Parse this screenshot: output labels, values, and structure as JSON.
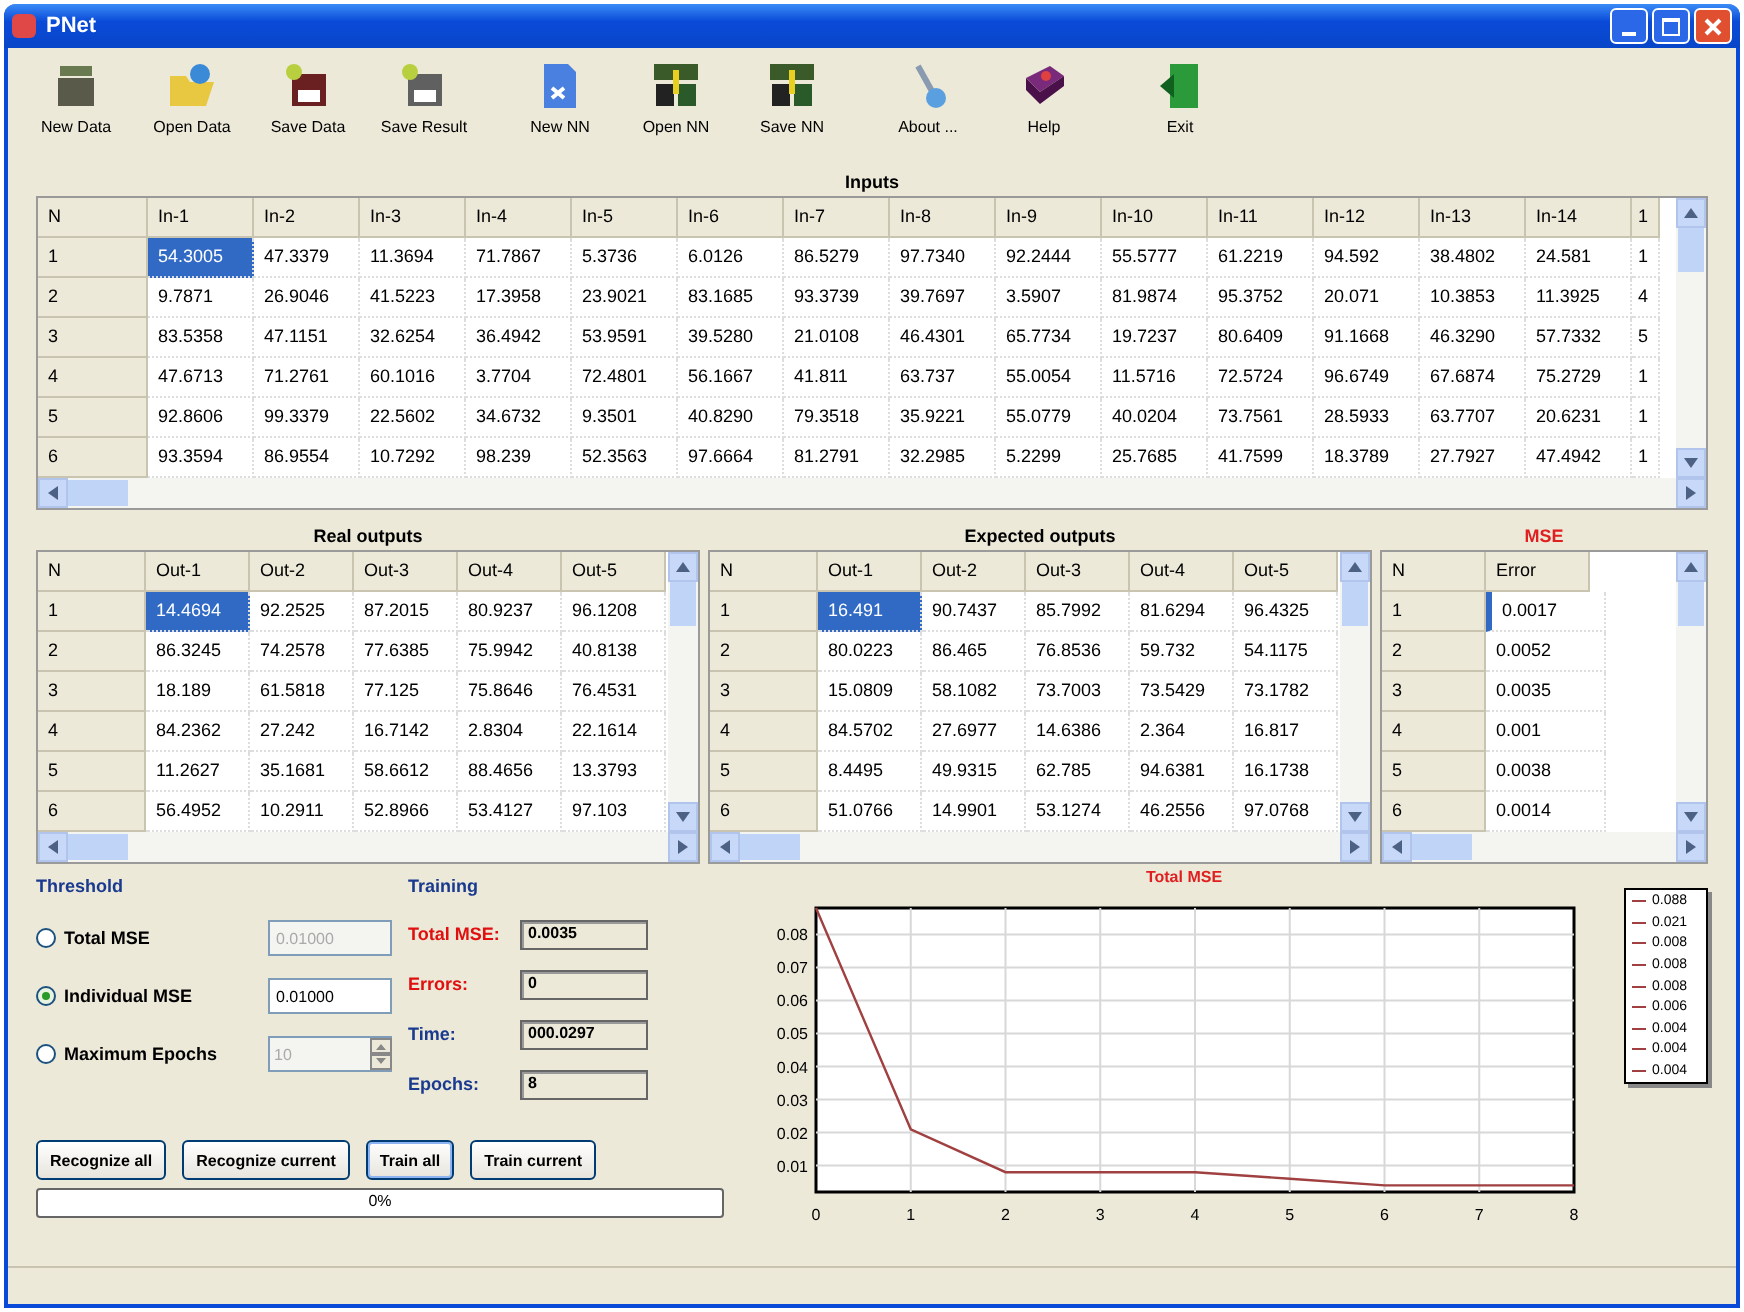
{
  "window": {
    "title": "PNet"
  },
  "toolbar": [
    {
      "label": "New Data",
      "kind": "new"
    },
    {
      "label": "Open Data",
      "kind": "open"
    },
    {
      "label": "Save Data",
      "kind": "save"
    },
    {
      "label": "Save Result",
      "kind": "saveresult"
    },
    {
      "label": "New NN",
      "kind": "newnn"
    },
    {
      "label": "Open NN",
      "kind": "opennn"
    },
    {
      "label": "Save NN",
      "kind": "savenn"
    },
    {
      "label": "About ...",
      "kind": "about"
    },
    {
      "label": "Help",
      "kind": "help"
    },
    {
      "label": "Exit",
      "kind": "exit"
    }
  ],
  "inputs": {
    "title": "Inputs",
    "columns": [
      "N",
      "In-1",
      "In-2",
      "In-3",
      "In-4",
      "In-5",
      "In-6",
      "In-7",
      "In-8",
      "In-9",
      "In-10",
      "In-11",
      "In-12",
      "In-13",
      "In-14",
      "1"
    ],
    "rows": [
      {
        "selected": true,
        "cells": [
          "1",
          "54.3005",
          "47.3379",
          "11.3694",
          "71.7867",
          "5.3736",
          "6.0126",
          "86.5279",
          "97.7340",
          "92.2444",
          "55.5777",
          "61.2219",
          "94.592",
          "38.4802",
          "24.581",
          "1"
        ]
      },
      {
        "selected": false,
        "cells": [
          "2",
          "9.7871",
          "26.9046",
          "41.5223",
          "17.3958",
          "23.9021",
          "83.1685",
          "93.3739",
          "39.7697",
          "3.5907",
          "81.9874",
          "95.3752",
          "20.071",
          "10.3853",
          "11.3925",
          "4"
        ]
      },
      {
        "selected": false,
        "cells": [
          "3",
          "83.5358",
          "47.1151",
          "32.6254",
          "36.4942",
          "53.9591",
          "39.5280",
          "21.0108",
          "46.4301",
          "65.7734",
          "19.7237",
          "80.6409",
          "91.1668",
          "46.3290",
          "57.7332",
          "5"
        ]
      },
      {
        "selected": false,
        "cells": [
          "4",
          "47.6713",
          "71.2761",
          "60.1016",
          "3.7704",
          "72.4801",
          "56.1667",
          "41.811",
          "63.737",
          "55.0054",
          "11.5716",
          "72.5724",
          "96.6749",
          "67.6874",
          "75.2729",
          "1"
        ]
      },
      {
        "selected": false,
        "cells": [
          "5",
          "92.8606",
          "99.3379",
          "22.5602",
          "34.6732",
          "9.3501",
          "40.8290",
          "79.3518",
          "35.9221",
          "55.0779",
          "40.0204",
          "73.7561",
          "28.5933",
          "63.7707",
          "20.6231",
          "1"
        ]
      },
      {
        "selected": false,
        "cells": [
          "6",
          "93.3594",
          "86.9554",
          "10.7292",
          "98.239",
          "52.3563",
          "97.6664",
          "81.2791",
          "32.2985",
          "5.2299",
          "25.7685",
          "41.7599",
          "18.3789",
          "27.7927",
          "47.4942",
          "1"
        ]
      }
    ]
  },
  "real_outputs": {
    "title": "Real outputs",
    "columns": [
      "N",
      "Out-1",
      "Out-2",
      "Out-3",
      "Out-4",
      "Out-5"
    ],
    "rows": [
      {
        "selected": true,
        "cells": [
          "1",
          "14.4694",
          "92.2525",
          "87.2015",
          "80.9237",
          "96.1208"
        ]
      },
      {
        "selected": false,
        "cells": [
          "2",
          "86.3245",
          "74.2578",
          "77.6385",
          "75.9942",
          "40.8138"
        ]
      },
      {
        "selected": false,
        "cells": [
          "3",
          "18.189",
          "61.5818",
          "77.125",
          "75.8646",
          "76.4531"
        ]
      },
      {
        "selected": false,
        "cells": [
          "4",
          "84.2362",
          "27.242",
          "16.7142",
          "2.8304",
          "22.1614"
        ]
      },
      {
        "selected": false,
        "cells": [
          "5",
          "11.2627",
          "35.1681",
          "58.6612",
          "88.4656",
          "13.3793"
        ]
      },
      {
        "selected": false,
        "cells": [
          "6",
          "56.4952",
          "10.2911",
          "52.8966",
          "53.4127",
          "97.103"
        ]
      }
    ]
  },
  "expected_outputs": {
    "title": "Expected outputs",
    "columns": [
      "N",
      "Out-1",
      "Out-2",
      "Out-3",
      "Out-4",
      "Out-5"
    ],
    "rows": [
      {
        "selected": true,
        "cells": [
          "1",
          "16.491",
          "90.7437",
          "85.7992",
          "81.6294",
          "96.4325"
        ]
      },
      {
        "selected": false,
        "cells": [
          "2",
          "80.0223",
          "86.465",
          "76.8536",
          "59.732",
          "54.1175"
        ]
      },
      {
        "selected": false,
        "cells": [
          "3",
          "15.0809",
          "58.1082",
          "73.7003",
          "73.5429",
          "73.1782"
        ]
      },
      {
        "selected": false,
        "cells": [
          "4",
          "84.5702",
          "27.6977",
          "14.6386",
          "2.364",
          "16.817"
        ]
      },
      {
        "selected": false,
        "cells": [
          "5",
          "8.4495",
          "49.9315",
          "62.785",
          "94.6381",
          "16.1738"
        ]
      },
      {
        "selected": false,
        "cells": [
          "6",
          "51.0766",
          "14.9901",
          "53.1274",
          "46.2556",
          "97.0768"
        ]
      }
    ]
  },
  "mse": {
    "title": "MSE",
    "columns": [
      "N",
      "Error"
    ],
    "rows": [
      {
        "selected": true,
        "cells": [
          "1",
          "0.0017"
        ]
      },
      {
        "selected": false,
        "cells": [
          "2",
          "0.0052"
        ]
      },
      {
        "selected": false,
        "cells": [
          "3",
          "0.0035"
        ]
      },
      {
        "selected": false,
        "cells": [
          "4",
          "0.001"
        ]
      },
      {
        "selected": false,
        "cells": [
          "5",
          "0.0038"
        ]
      },
      {
        "selected": false,
        "cells": [
          "6",
          "0.0014"
        ]
      }
    ]
  },
  "threshold": {
    "title": "Threshold",
    "options": [
      {
        "label": "Total MSE",
        "selected": false,
        "kind": "input",
        "value": "0.01000",
        "disabled": true
      },
      {
        "label": "Individual MSE",
        "selected": true,
        "kind": "input",
        "value": "0.01000",
        "disabled": false
      },
      {
        "label": "Maximum Epochs",
        "selected": false,
        "kind": "spin",
        "value": "10",
        "disabled": true
      }
    ]
  },
  "training": {
    "title": "Training",
    "fields": [
      {
        "label": "Total MSE:",
        "value": "0.0035",
        "color": "#e01010"
      },
      {
        "label": "Errors:",
        "value": "0",
        "color": "#e01010"
      },
      {
        "label": "Time:",
        "value": "000.0297",
        "color": "#1a3a90"
      },
      {
        "label": "Epochs:",
        "value": "8",
        "color": "#1a3a90"
      }
    ]
  },
  "buttons": [
    "Recognize all",
    "Recognize current",
    "Train all",
    "Train current"
  ],
  "progress": {
    "level": 0,
    "label": "0%"
  },
  "chart": {
    "chart_data": {
      "type": "line",
      "title": "Total MSE",
      "categories": [
        "0",
        "1",
        "2",
        "3",
        "4",
        "5",
        "6",
        "7",
        "8"
      ],
      "series": [
        {
          "color": "#a04040",
          "values": [
            0.088,
            0.021,
            0.008,
            0.008,
            0.008,
            0.006,
            0.004,
            0.004,
            0.004
          ]
        }
      ],
      "ylim": [
        0.002,
        0.088
      ],
      "yticks": [
        0.01,
        0.02,
        0.03,
        0.04,
        0.05,
        0.06,
        0.07,
        0.08
      ],
      "grid": true
    },
    "legend": [
      "0.088",
      "0.021",
      "0.008",
      "0.008",
      "0.008",
      "0.006",
      "0.004",
      "0.004",
      "0.004"
    ]
  }
}
